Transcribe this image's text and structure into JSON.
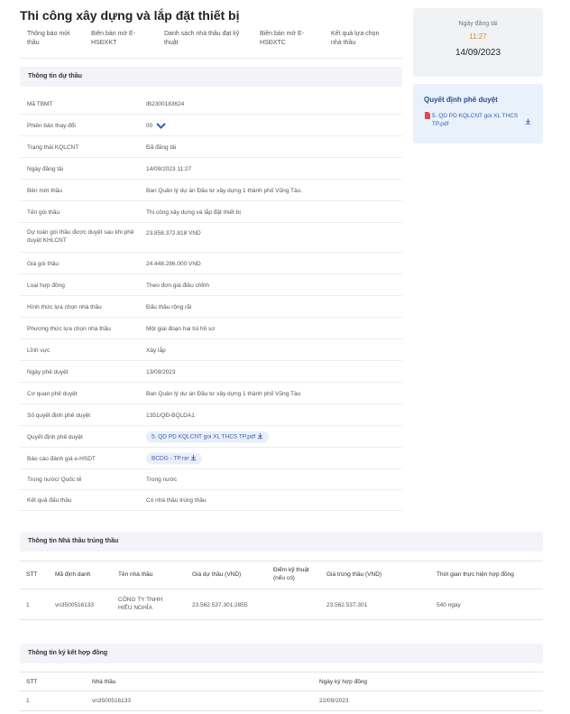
{
  "page_title": "Thi công xây dựng và lắp đặt thiết bị",
  "tabs": [
    {
      "label": "Thông báo mời thầu"
    },
    {
      "label": "Biên bản mở E-HSĐXKT"
    },
    {
      "label": "Danh sách nhà thầu đạt kỹ thuật"
    },
    {
      "label": "Biên bản mở E-HSĐXTC"
    },
    {
      "label": "Kết quả lựa chọn nhà thầu"
    }
  ],
  "info_section": {
    "title": "Thông tin dự thầu",
    "rows": [
      {
        "label": "Mã TBMT",
        "value": "IB2300183624"
      },
      {
        "label": "Phiên bản thay đổi",
        "value": "00"
      },
      {
        "label": "Trạng thái KQLCNT",
        "value": "Đã đăng tải"
      },
      {
        "label": "Ngày đăng tải",
        "value": "14/09/2023 11:27"
      },
      {
        "label": "Bên mời thầu",
        "value": "Ban Quản lý dự án Đầu tư xây dựng 1 thành phố Vũng Tàu."
      },
      {
        "label": "Tên gói thầu",
        "value": "Thi công xây dựng và lắp đặt thiết bị"
      },
      {
        "label": "Dự toán gói thầu được duyệt sau khi phê duyệt KHLCNT",
        "value": "23.858.372.818 VND"
      },
      {
        "label": "Giá gói thầu",
        "value": "24.448.286.000 VND"
      },
      {
        "label": "Loại hợp đồng",
        "value": "Theo đơn giá điều chỉnh"
      },
      {
        "label": "Hình thức lựa chọn nhà thầu",
        "value": "Đấu thầu rộng rãi"
      },
      {
        "label": "Phương thức lựa chọn nhà thầu",
        "value": "Một giai đoạn hai túi hồ sơ"
      },
      {
        "label": "Lĩnh vực",
        "value": "Xây lắp"
      },
      {
        "label": "Ngày phê duyệt",
        "value": "13/09/2023"
      },
      {
        "label": "Cơ quan phê duyệt",
        "value": "Ban Quản lý dự án Đầu tư xây dựng 1 thành phố Vũng Tàu"
      },
      {
        "label": "Số quyết định phê duyệt",
        "value": "1351/QĐ-BQLDA1"
      },
      {
        "label": "Quyết định phê duyệt",
        "value": "5. QD PD KQLCNT goi XL THCS TP.pdf"
      },
      {
        "label": "Báo cáo đánh giá e-HSDT",
        "value": "BCDG - TP.rar"
      },
      {
        "label": "Trong nước/ Quốc tế",
        "value": "Trong nước"
      },
      {
        "label": "Kết quả đấu thầu",
        "value": "Có nhà thầu trúng thầu"
      }
    ]
  },
  "side_date": {
    "label": "Ngày đăng tải",
    "time": "11:27",
    "date": "14/09/2023"
  },
  "side_decision": {
    "title": "Quyết định phê duyệt",
    "file": "5. QD PD KQLCNT goi XL THCS TP.pdf"
  },
  "winner_section": {
    "title": "Thông tin Nhà thầu trúng thầu",
    "columns": [
      "STT",
      "Mã định danh",
      "Tên nhà thầu",
      "Giá dự thầu (VND)",
      "Điểm kỹ thuật (nếu có)",
      "Giá trúng thầu (VND)",
      "Thời gian thực hiện hợp đồng"
    ],
    "row": [
      "1",
      "vn3500516133",
      "CÔNG TY TNHH HIẾU NGHĨA",
      "23.562.537.301,2855",
      "",
      "23.562.537.301",
      "540 ngày"
    ]
  },
  "contract_section": {
    "title": "Thông tin ký kết hợp đồng",
    "columns": [
      "STT",
      "Nhà thầu",
      "Ngày ký hợp đồng"
    ],
    "row": [
      "1",
      "vn3500516133",
      "22/09/2023"
    ]
  },
  "colors": {
    "accent": "#3b5ea8",
    "time": "#d98a2a",
    "header_bg": "#f2f4f7"
  }
}
